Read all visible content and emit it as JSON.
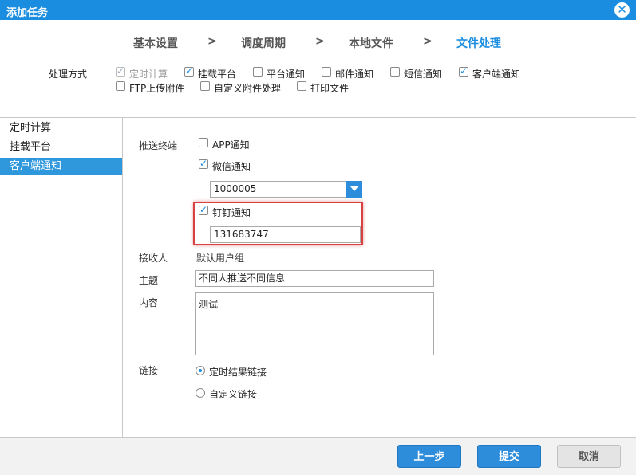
{
  "window": {
    "title": "添加任务"
  },
  "steps": [
    {
      "label": "基本设置"
    },
    {
      "label": "调度周期"
    },
    {
      "label": "本地文件"
    },
    {
      "label": "文件处理"
    }
  ],
  "step_separator": ">",
  "method": {
    "label": "处理方式",
    "options": [
      {
        "label": "定时计算",
        "checked": true,
        "disabled": true
      },
      {
        "label": "挂载平台",
        "checked": true
      },
      {
        "label": "平台通知",
        "checked": false
      },
      {
        "label": "邮件通知",
        "checked": false
      },
      {
        "label": "短信通知",
        "checked": false
      },
      {
        "label": "客户端通知",
        "checked": true
      },
      {
        "label": "FTP上传附件",
        "checked": false
      },
      {
        "label": "自定义附件处理",
        "checked": false
      },
      {
        "label": "打印文件",
        "checked": false
      }
    ]
  },
  "sidebar": {
    "items": [
      {
        "label": "定时计算"
      },
      {
        "label": "挂载平台"
      },
      {
        "label": "客户端通知",
        "active": true
      }
    ]
  },
  "form": {
    "push_label": "推送终端",
    "app_notify": {
      "label": "APP通知",
      "checked": false
    },
    "wechat_notify": {
      "label": "微信通知",
      "checked": true,
      "value": "1000005"
    },
    "dingtalk_notify": {
      "label": "钉钉通知",
      "checked": true,
      "value": "131683747"
    },
    "receiver_label": "接收人",
    "receiver_value": "默认用户组",
    "subject_label": "主题",
    "subject_value": "不同人推送不同信息",
    "content_label": "内容",
    "content_value": "测试",
    "link_label": "链接",
    "link_options": [
      {
        "label": "定时结果链接",
        "checked": true
      },
      {
        "label": "自定义链接",
        "checked": false
      }
    ]
  },
  "footer": {
    "prev_label": "上一步",
    "submit_label": "提交",
    "cancel_label": "取消"
  },
  "colors": {
    "accent": "#1a8de0",
    "highlight": "#d94040"
  }
}
